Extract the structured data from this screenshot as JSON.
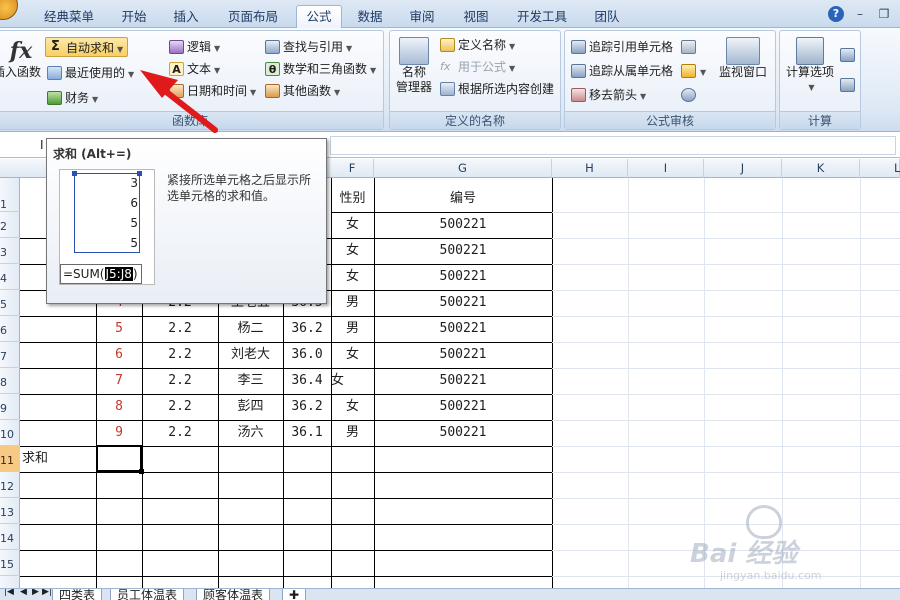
{
  "tabs": [
    {
      "label": "经典菜单",
      "left": 0
    },
    {
      "label": "开始",
      "left": 0
    },
    {
      "label": "插入",
      "left": 0
    },
    {
      "label": "页面布局",
      "left": 0
    },
    {
      "label": "公式",
      "left": 0,
      "active": true
    },
    {
      "label": "数据",
      "left": 0
    },
    {
      "label": "审阅",
      "left": 0
    },
    {
      "label": "视图",
      "left": 0
    },
    {
      "label": "开发工具",
      "left": 0
    },
    {
      "label": "团队",
      "left": 0
    }
  ],
  "ribbon": {
    "insert_function": "插入函数",
    "autosum": "自动求和",
    "recent": "最近使用的",
    "finance": "财务",
    "logic": "逻辑",
    "text": "文本",
    "datetime": "日期和时间",
    "lookup": "查找与引用",
    "math": "数学和三角函数",
    "other": "其他函数",
    "group_library": "函数库",
    "name_manager_1": "名称",
    "name_manager_2": "管理器",
    "define_name": "定义名称",
    "use_in_formula": "用于公式",
    "create_from_selection": "根据所选内容创建",
    "group_names": "定义的名称",
    "trace_precedents": "追踪引用单元格",
    "trace_dependents": "追踪从属单元格",
    "remove_arrows": "移去箭头",
    "watch_window": "监视窗口",
    "group_audit": "公式审核",
    "calc_options": "计算选项",
    "group_calc": "计算"
  },
  "name_box": "I",
  "tooltip": {
    "title": "求和 (Alt+=)",
    "description": "紧接所选单元格之后显示所选单元格的求和值。",
    "preview_values": [
      "3",
      "6",
      "5",
      "5"
    ],
    "formula_prefix": "=SUM(",
    "formula_highlight": "J5:J8",
    "formula_suffix": ")"
  },
  "columns": [
    "F",
    "G",
    "H",
    "I",
    "J",
    "K",
    "L"
  ],
  "header_row": {
    "gender": "性别",
    "id": "编号"
  },
  "rows_visible": [
    "1",
    "2",
    "3",
    "4",
    "5",
    "6",
    "7",
    "8",
    "9",
    "10",
    "11",
    "12",
    "13",
    "14",
    "15"
  ],
  "data_rows": [
    {
      "gender": "女",
      "id": "500221"
    },
    {
      "gender": "女",
      "id": "500221"
    },
    {
      "gender": "女",
      "id": "500221"
    },
    {
      "num": "4",
      "w": "2.2",
      "name": "王老五",
      "temp": "36.5",
      "gender": "男",
      "id": "500221"
    },
    {
      "num": "5",
      "w": "2.2",
      "name": "杨二",
      "temp": "36.2",
      "gender": "男",
      "id": "500221"
    },
    {
      "num": "6",
      "w": "2.2",
      "name": "刘老大",
      "temp": "36.0",
      "gender": "女",
      "id": "500221"
    },
    {
      "num": "7",
      "w": "2.2",
      "name": "李三",
      "temp": "36.4",
      "gender": "女",
      "id": "500221"
    },
    {
      "num": "8",
      "w": "2.2",
      "name": "彭四",
      "temp": "36.2",
      "gender": "女",
      "id": "500221"
    },
    {
      "num": "9",
      "w": "2.2",
      "name": "汤六",
      "temp": "36.1",
      "gender": "男",
      "id": "500221"
    }
  ],
  "sum_label": "求和",
  "sheet_tabs": [
    "四类表",
    "员工体温表",
    "顾客体温表"
  ],
  "watermark": {
    "main": "Bai 经验",
    "sub": "jingyan.baidu.com"
  },
  "colors": {
    "accent_red": "#e0191b",
    "active_row": "#f7c985",
    "number_red": "#c0392b"
  }
}
